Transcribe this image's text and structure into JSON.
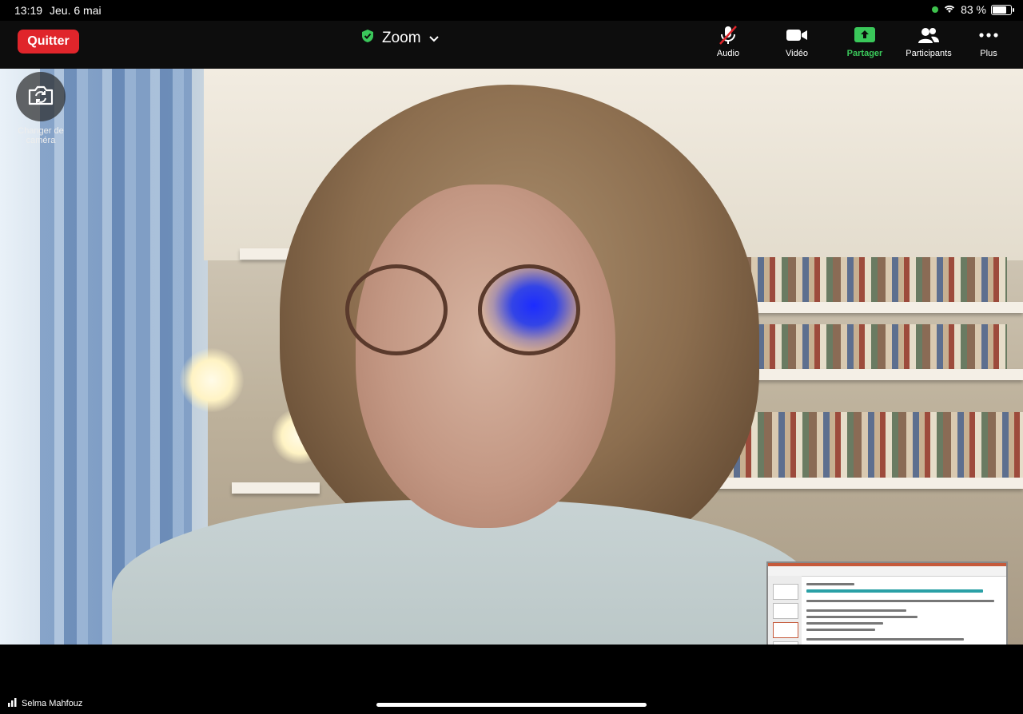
{
  "status": {
    "time": "13:19",
    "date": "Jeu. 6 mai",
    "battery_label": "83 %",
    "battery_level": 0.83
  },
  "toolbar": {
    "quit_label": "Quitter",
    "meeting_title": "Zoom",
    "audio_label": "Audio",
    "video_label": "Vidéo",
    "share_label": "Partager",
    "participants_label": "Participants",
    "more_label": "Plus"
  },
  "video": {
    "switch_camera_label": "Changer de caméra"
  },
  "participant": {
    "name": "Selma Mahfouz"
  },
  "colors": {
    "quit": "#e0252b",
    "share": "#3ac75a",
    "secure": "#3ac75a"
  }
}
